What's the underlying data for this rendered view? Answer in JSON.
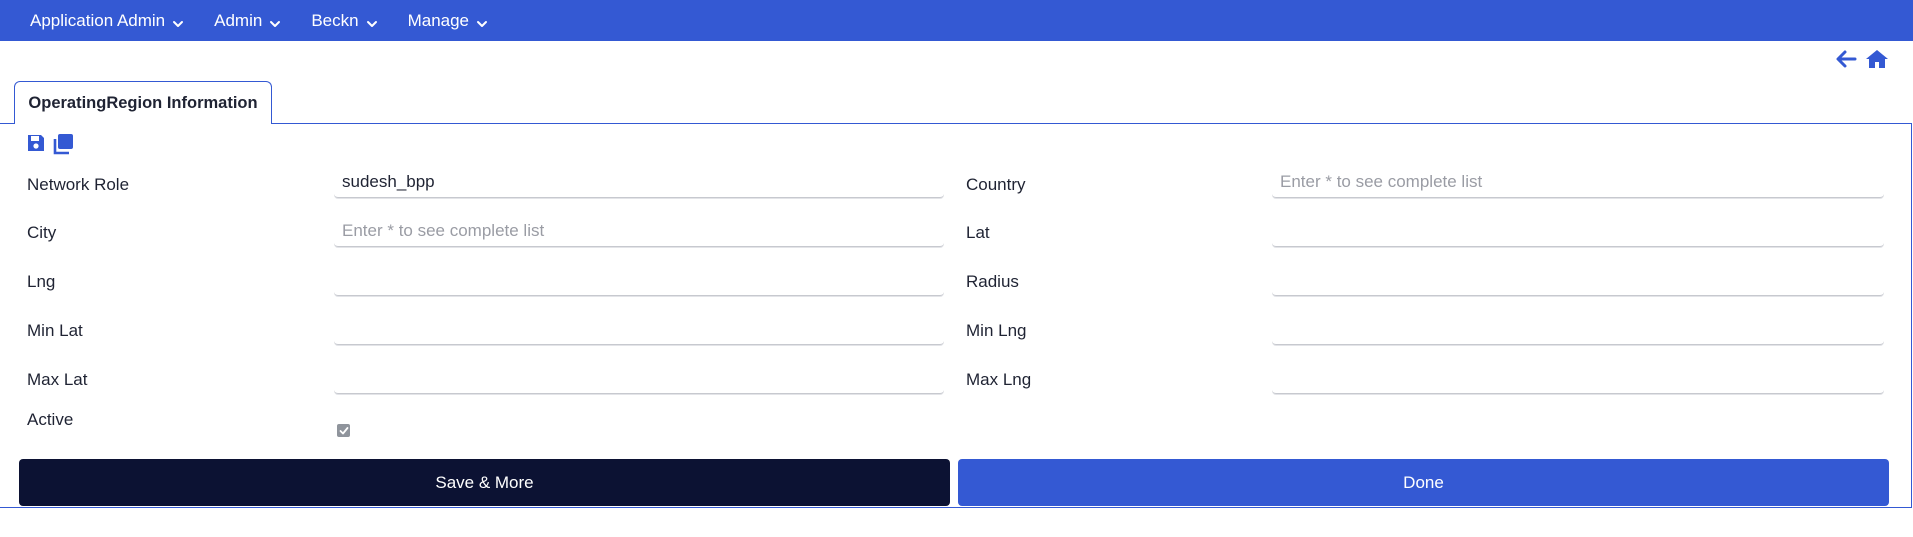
{
  "navbar": {
    "items": [
      {
        "label": "Application Admin"
      },
      {
        "label": "Admin"
      },
      {
        "label": "Beckn"
      },
      {
        "label": "Manage"
      }
    ]
  },
  "tab": {
    "label": "OperatingRegion Information"
  },
  "form": {
    "network_role": {
      "label": "Network Role",
      "value": "sudesh_bpp"
    },
    "country": {
      "label": "Country",
      "value": "",
      "placeholder": "Enter * to see complete list"
    },
    "city": {
      "label": "City",
      "value": "",
      "placeholder": "Enter * to see complete list"
    },
    "lat": {
      "label": "Lat",
      "value": ""
    },
    "lng": {
      "label": "Lng",
      "value": ""
    },
    "radius": {
      "label": "Radius",
      "value": ""
    },
    "min_lat": {
      "label": "Min Lat",
      "value": ""
    },
    "min_lng": {
      "label": "Min Lng",
      "value": ""
    },
    "max_lat": {
      "label": "Max Lat",
      "value": ""
    },
    "max_lng": {
      "label": "Max Lng",
      "value": ""
    },
    "active": {
      "label": "Active",
      "checked": true
    }
  },
  "buttons": {
    "save_more": "Save & More",
    "done": "Done"
  },
  "colors": {
    "accent": "#3459d3",
    "dark": "#0c1233"
  }
}
